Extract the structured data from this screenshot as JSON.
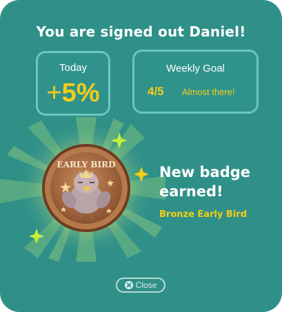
{
  "header": {
    "title": "You are signed out Daniel!"
  },
  "today": {
    "label": "Today",
    "sign": "+",
    "value": "5%"
  },
  "weekly_goal": {
    "label": "Weekly Goal",
    "count": "4/5",
    "note": "Almost there!"
  },
  "badge": {
    "headline": "New badge earned!",
    "name": "Bronze Early Bird",
    "medal_text": "EARLY BIRD"
  },
  "close_button": {
    "label": "Close"
  },
  "colors": {
    "background": "#2f9088",
    "accent": "#f5cd16",
    "box_border": "#6cc6c2",
    "sparkle": "#c6ee3a"
  },
  "icons": [
    "sparkle-icon",
    "early-bird-medal",
    "close-icon"
  ]
}
